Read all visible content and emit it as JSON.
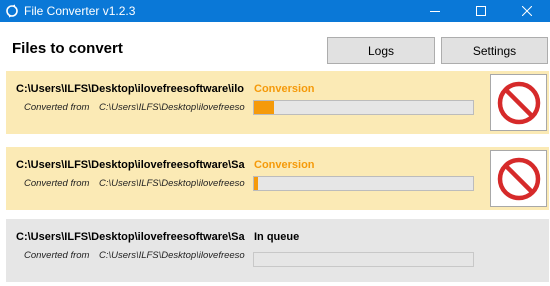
{
  "window": {
    "title": "File Converter v1.2.3",
    "controls": [
      "minimize",
      "maximize",
      "close"
    ]
  },
  "header": {
    "title": "Files to convert",
    "logs_label": "Logs",
    "settings_label": "Settings"
  },
  "colors": {
    "titlebar": "#0a78d7",
    "active_card": "#fbeab5",
    "queued_card": "#e6e6e6",
    "accent_orange": "#f59a0a",
    "cancel_red": "#d62a2a"
  },
  "jobs": [
    {
      "path": "C:\\Users\\ILFS\\Desktop\\ilovefreesoftware\\ilo",
      "status": "Conversion",
      "from_label": "Converted from",
      "from_path": "C:\\Users\\ILFS\\Desktop\\ilovefreeso",
      "progress": 0.09,
      "cancel_icon": "cancel-icon"
    },
    {
      "path": "C:\\Users\\ILFS\\Desktop\\ilovefreesoftware\\Sa",
      "status": "Conversion",
      "from_label": "Converted from",
      "from_path": "C:\\Users\\ILFS\\Desktop\\ilovefreeso",
      "progress": 0.02,
      "cancel_icon": "cancel-icon"
    },
    {
      "path": "C:\\Users\\ILFS\\Desktop\\ilovefreesoftware\\Sa",
      "status": "In queue",
      "from_label": "Converted from",
      "from_path": "C:\\Users\\ILFS\\Desktop\\ilovefreeso",
      "progress": 0
    }
  ]
}
